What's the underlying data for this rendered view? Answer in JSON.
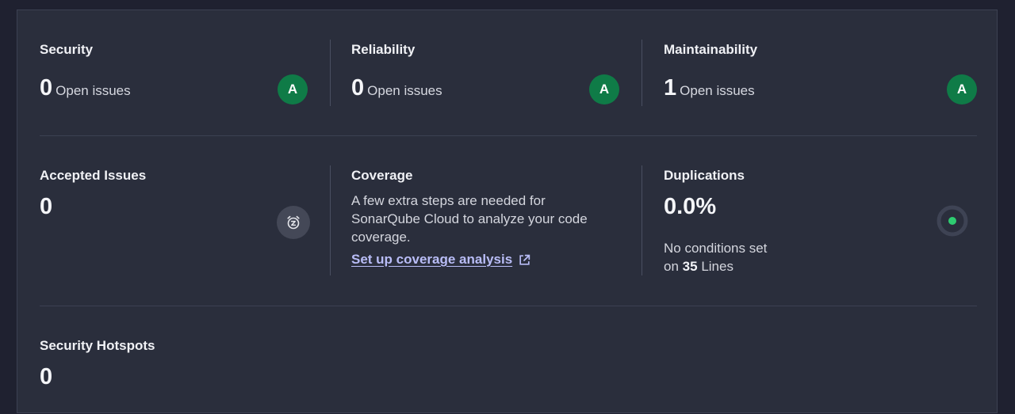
{
  "security": {
    "title": "Security",
    "count": "0",
    "label": "Open issues",
    "grade": "A"
  },
  "reliability": {
    "title": "Reliability",
    "count": "0",
    "label": "Open issues",
    "grade": "A"
  },
  "maintainability": {
    "title": "Maintainability",
    "count": "1",
    "label": "Open issues",
    "grade": "A"
  },
  "accepted": {
    "title": "Accepted Issues",
    "count": "0",
    "icon": "snooze-clock-icon"
  },
  "coverage": {
    "title": "Coverage",
    "description": "A few extra steps are needed for SonarQube Cloud to analyze your code coverage.",
    "link_label": "Set up coverage analysis",
    "link_icon": "external-link-icon"
  },
  "duplications": {
    "title": "Duplications",
    "value": "0.0%",
    "line1": "No conditions set",
    "line2_prefix": "on",
    "line2_count": "35",
    "line2_suffix": "Lines",
    "indicator_color": "#2ecc71"
  },
  "hotspots": {
    "title": "Security Hotspots",
    "count": "0"
  },
  "colors": {
    "grade_a": "#0f7b47",
    "link": "#b9bdf7"
  }
}
